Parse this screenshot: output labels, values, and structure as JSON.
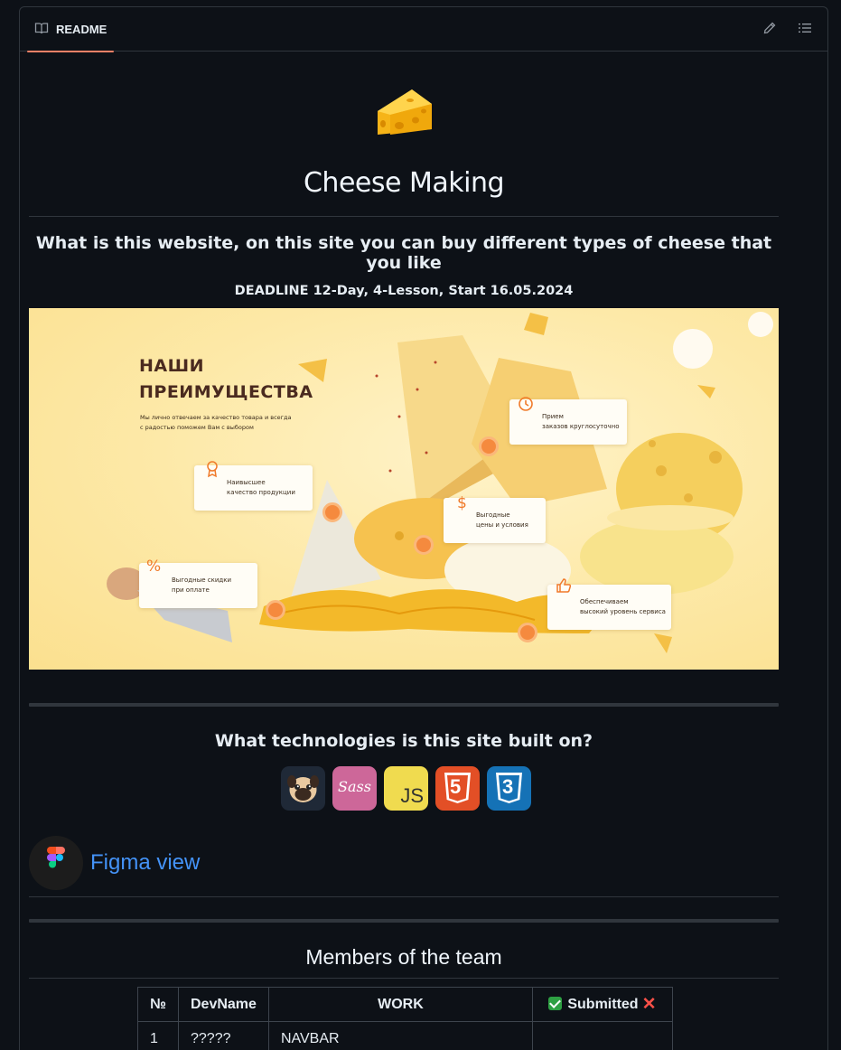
{
  "header": {
    "tab_label": "README",
    "tab_icon": "book-icon",
    "edit_icon": "pencil-icon",
    "outline_icon": "list-icon"
  },
  "readme": {
    "title": "Cheese Making",
    "subtitle": "What is this website, on this site you can buy different types of cheese that you like",
    "deadline": "DEADLINE 12-Day, 4-Lesson, Start 16.05.2024",
    "banner": {
      "heading_line1": "НАШИ",
      "heading_line2": "ПРЕИМУЩЕСТВА",
      "desc_line1": "Мы лично отвечаем за качество товара и всегда",
      "desc_line2": "с радостью поможем Вам с выбором",
      "cards": [
        {
          "line1": "Прием",
          "line2": "заказов круглосуточно"
        },
        {
          "line1": "Наивысшее",
          "line2": "качество продукции"
        },
        {
          "line1": "Выгодные",
          "line2": "цены и условия"
        },
        {
          "line1": "Выгодные скидки",
          "line2": "при оплате"
        },
        {
          "line1": "Обеспечиваем",
          "line2": "высокий уровень сервиса"
        }
      ]
    },
    "tech_title": "What technologies is this site built on?",
    "tech": [
      {
        "name": "pug",
        "icon": "pug-icon",
        "color": "#1f2937"
      },
      {
        "name": "sass",
        "icon": "sass-icon",
        "color": "#cd6799",
        "text": "Sass"
      },
      {
        "name": "javascript",
        "icon": "javascript-icon",
        "color": "#f0db4f",
        "text": "JS"
      },
      {
        "name": "html5",
        "icon": "html5-icon",
        "color": "#e34f26",
        "text": "5"
      },
      {
        "name": "css3",
        "icon": "css3-icon",
        "color": "#1572b6",
        "text": "3"
      }
    ],
    "figma_link": "Figma view",
    "members_title": "Members of the team",
    "table": {
      "headers": [
        "№",
        "DevName",
        "WORK",
        "Submitted"
      ],
      "rows": [
        {
          "no": "1",
          "dev": "?????",
          "work": "NAVBAR",
          "submitted": ""
        }
      ]
    }
  },
  "colors": {
    "background": "#0d1117",
    "border": "#30363d",
    "tab_underline": "#f78166",
    "link": "#4493f8"
  }
}
